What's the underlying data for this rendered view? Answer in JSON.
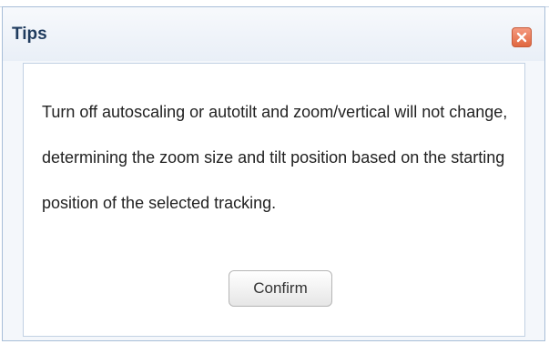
{
  "dialog": {
    "title": "Tips",
    "message": "Turn off autoscaling or autotilt and zoom/vertical will not change, determining the zoom size and tilt position based on the starting position of the selected tracking.",
    "confirm_label": "Confirm",
    "close_icon": "close-icon"
  },
  "colors": {
    "title_text": "#1f3b5e",
    "dialog_border": "#a8bed8",
    "close_button": "#e0673f"
  }
}
